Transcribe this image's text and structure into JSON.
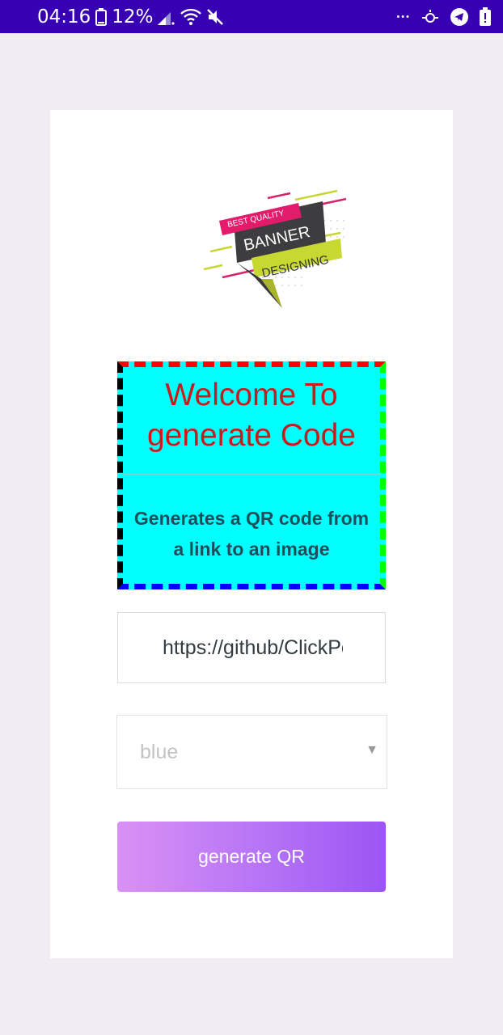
{
  "status_bar": {
    "time": "04:16",
    "battery_percent": "12%",
    "overflow_dots": "•••",
    "background_color": "#3700b3"
  },
  "logo": {
    "ribbon_top": "BEST QUALITY",
    "banner_text": "BANNER",
    "ribbon_bottom": "DESIGNING"
  },
  "welcome": {
    "title_line1": "Welcome To",
    "title_line2": "generate Code",
    "subtitle_line1": "Generates a QR code from",
    "subtitle_line2": "a link to an image",
    "background_color": "#00ffff",
    "title_color": "#cc1a1a"
  },
  "form": {
    "url_value": "https://github/ClickPesa",
    "color_selected": "blue",
    "button_label": "generate QR",
    "button_gradient": [
      "#da91f5",
      "#9c55f3"
    ]
  },
  "icons": {
    "battery": "battery-icon",
    "signal": "signal-icon",
    "wifi": "wifi-icon",
    "mute": "mute-icon",
    "data_saver": "data-saver-icon",
    "telegram": "telegram-icon",
    "alert": "alert-icon",
    "dropdown": "chevron-down-icon"
  }
}
